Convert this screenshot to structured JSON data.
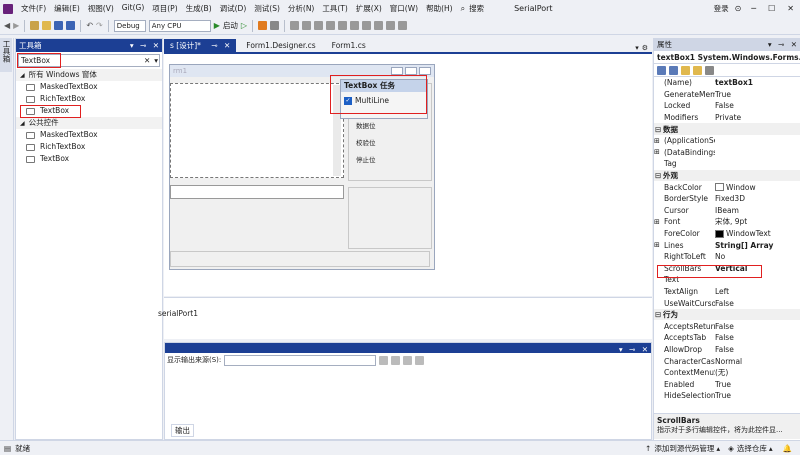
{
  "menu": [
    "文件(F)",
    "编辑(E)",
    "视图(V)",
    "Git(G)",
    "项目(P)",
    "生成(B)",
    "调试(D)",
    "测试(S)",
    "分析(N)",
    "工具(T)",
    "扩展(X)",
    "窗口(W)",
    "帮助(H)"
  ],
  "search_label": "搜索",
  "app_title": "SerialPort",
  "login_label": "登录",
  "toolbar": {
    "config": "Debug",
    "platform": "Any CPU",
    "start": "启动"
  },
  "left_tab_label": "工具箱",
  "toolbox": {
    "title": "工具箱",
    "search_value": "TextBox",
    "sections": [
      {
        "name": "所有 Windows 窗体",
        "items": [
          "MaskedTextBox",
          "RichTextBox",
          "TextBox"
        ]
      },
      {
        "name": "公共控件",
        "items": [
          "MaskedTextBox",
          "RichTextBox",
          "TextBox"
        ]
      }
    ]
  },
  "doc_tabs": [
    "s [设计]*",
    "Form1.Designer.cs",
    "Form1.cs"
  ],
  "form": {
    "title": "rm1",
    "labels": [
      "数据位",
      "校验位",
      "停止位"
    ]
  },
  "smart_tag": {
    "title": "TextBox 任务",
    "multiline": "MultiLine"
  },
  "component_tray": {
    "item": "serialPort1"
  },
  "output": {
    "source_label": "显示输出来源(S):",
    "tab": "输出"
  },
  "properties": {
    "title": "属性",
    "object": "textBox1 System.Windows.Forms.T",
    "rows": [
      {
        "n": "(Name)",
        "v": "textBox1",
        "b": true
      },
      {
        "n": "GenerateMemb",
        "v": "True"
      },
      {
        "n": "Locked",
        "v": "False"
      },
      {
        "n": "Modifiers",
        "v": "Private"
      },
      {
        "cat": "数据"
      },
      {
        "n": "(ApplicationSet",
        "v": "",
        "exp": true
      },
      {
        "n": "(DataBindings)",
        "v": "",
        "exp": true
      },
      {
        "n": "Tag",
        "v": ""
      },
      {
        "cat": "外观"
      },
      {
        "n": "BackColor",
        "v": "Window",
        "sw": "#ffffff"
      },
      {
        "n": "BorderStyle",
        "v": "Fixed3D"
      },
      {
        "n": "Cursor",
        "v": "IBeam"
      },
      {
        "n": "Font",
        "v": "宋体, 9pt",
        "exp": true
      },
      {
        "n": "ForeColor",
        "v": "WindowText",
        "sw": "#000000"
      },
      {
        "n": "Lines",
        "v": "String[] Array",
        "b": true,
        "exp": true
      },
      {
        "n": "RightToLeft",
        "v": "No"
      },
      {
        "n": "ScrollBars",
        "v": "Vertical",
        "b": true
      },
      {
        "n": "Text",
        "v": ""
      },
      {
        "n": "TextAlign",
        "v": "Left"
      },
      {
        "n": "UseWaitCursor",
        "v": "False"
      },
      {
        "cat": "行为"
      },
      {
        "n": "AcceptsReturn",
        "v": "False"
      },
      {
        "n": "AcceptsTab",
        "v": "False"
      },
      {
        "n": "AllowDrop",
        "v": "False"
      },
      {
        "n": "CharacterCasing",
        "v": "Normal"
      },
      {
        "n": "ContextMenuSt",
        "v": "(无)"
      },
      {
        "n": "Enabled",
        "v": "True"
      },
      {
        "n": "HideSelection",
        "v": "True"
      }
    ],
    "desc_title": "ScrollBars",
    "desc_text": "指示对于多行编辑控件，将为此控件显..."
  },
  "status": {
    "ready": "就绪",
    "source_control": "添加到源代码管理",
    "repo": "选择仓库"
  },
  "colors": {
    "accent": "#1c3f94",
    "highlight": "#e02020"
  }
}
